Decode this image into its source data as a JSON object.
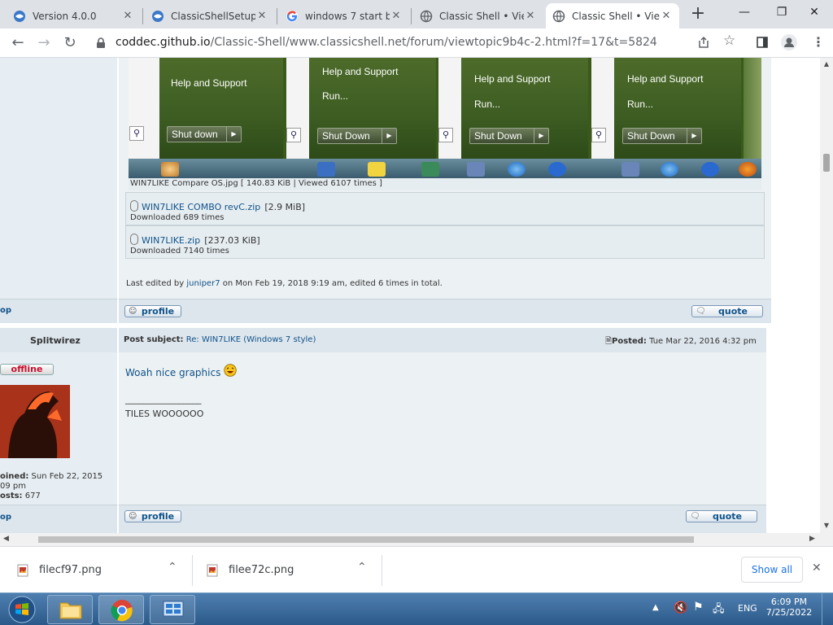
{
  "browser": {
    "tabs": [
      {
        "title": "Version 4.0.0",
        "close": "✕"
      },
      {
        "title": "ClassicShellSetup_…",
        "close": "✕"
      },
      {
        "title": "windows 7 start bu…",
        "close": "✕"
      },
      {
        "title": "Classic Shell • View…",
        "close": "✕"
      },
      {
        "title": "Classic Shell • View…",
        "close": "✕"
      }
    ],
    "new_tab": "+",
    "url_host": "coddec.github.io",
    "url_path": "/Classic-Shell/www.classicshell.net/forum/viewtopic9b4c-2.html?f=17&t=5824"
  },
  "attachment_image": {
    "menus": [
      {
        "help": "Help and Support",
        "run": "",
        "shutdown": "Shut down"
      },
      {
        "help": "Help and Support",
        "run": "Run...",
        "shutdown": "Shut Down"
      },
      {
        "help": "Help and Support",
        "run": "Run...",
        "shutdown": "Shut Down"
      },
      {
        "help": "Help and Support",
        "run": "Run...",
        "shutdown": "Shut Down"
      }
    ],
    "caption": "WIN7LIKE Compare OS.jpg [ 140.83 KiB | Viewed 6107 times ]"
  },
  "attachments": [
    {
      "name": "WIN7LIKE COMBO revC.zip",
      "size": "[2.9 MiB]",
      "downloads": "Downloaded 689 times"
    },
    {
      "name": "WIN7LIKE.zip",
      "size": "[237.03 KiB]",
      "downloads": "Downloaded 7140 times"
    }
  ],
  "post1": {
    "edited_prefix": "Last edited by",
    "edited_user": "juniper7",
    "edited_suffix": "on Mon Feb 19, 2018 9:19 am, edited 6 times in total.",
    "top_link": "op",
    "profile_label": "profile",
    "quote_label": "quote"
  },
  "post2": {
    "author": "Splitwirez",
    "subject_label": "Post subject:",
    "subject": "Re: WIN7LIKE (Windows 7 style)",
    "posted_label": "Posted:",
    "posted": "Tue Mar 22, 2016 4:32 pm",
    "status": "offline",
    "message": "Woah nice graphics",
    "signature_rule": "_________________",
    "signature": "TILES WOOOOOO",
    "joined_label": "oined:",
    "joined": "Sun Feb 22, 2015",
    "joined_time": "09 pm",
    "posts_label": "osts:",
    "posts": "677",
    "top_link": "op",
    "profile_label": "profile",
    "quote_label": "quote"
  },
  "downloads_bar": {
    "items": [
      {
        "name": "filecf97.png"
      },
      {
        "name": "filee72c.png"
      }
    ],
    "show_all": "Show all",
    "close": "✕"
  },
  "taskbar": {
    "language": "ENG",
    "time": "6:09 PM",
    "date": "7/25/2022"
  },
  "colors": {
    "link": "#105289",
    "forum_bg": "#ecf1f3",
    "taskbar": "#2b5a8a"
  }
}
